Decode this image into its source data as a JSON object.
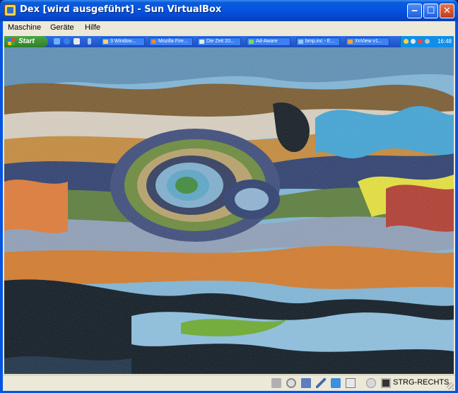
{
  "window": {
    "title": "Dex [wird ausgeführt] - Sun VirtualBox",
    "icons": {
      "app": "virtualbox-app-icon",
      "minimize": "minimize-icon",
      "maximize": "maximize-icon",
      "close": "close-icon"
    }
  },
  "menubar": {
    "items": [
      {
        "label": "Maschine"
      },
      {
        "label": "Geräte"
      },
      {
        "label": "Hilfe"
      }
    ]
  },
  "guest": {
    "start_label": "Start",
    "tasks": [
      {
        "label": "3 Window..."
      },
      {
        "label": "Mozilla Fire..."
      },
      {
        "label": "Die Zeit 20..."
      },
      {
        "label": "Ad-Aware"
      },
      {
        "label": "bmp.inc - E..."
      },
      {
        "label": "XnView v1..."
      }
    ],
    "clock": "16:48"
  },
  "statusbar": {
    "host_key_label": "STRG-RECHTS",
    "icons": [
      "hard-disk-icon",
      "cd-icon",
      "network-icon",
      "usb-icon",
      "shared-folder-icon",
      "display-icon",
      "mouse-integration-icon",
      "host-key-icon"
    ]
  },
  "colors": {
    "title_bar": "#0554e3",
    "menubar_bg": "#ece9d8",
    "taskbar": "#245edb",
    "start_button": "#3c9b37",
    "close_button": "#c23a1c"
  }
}
